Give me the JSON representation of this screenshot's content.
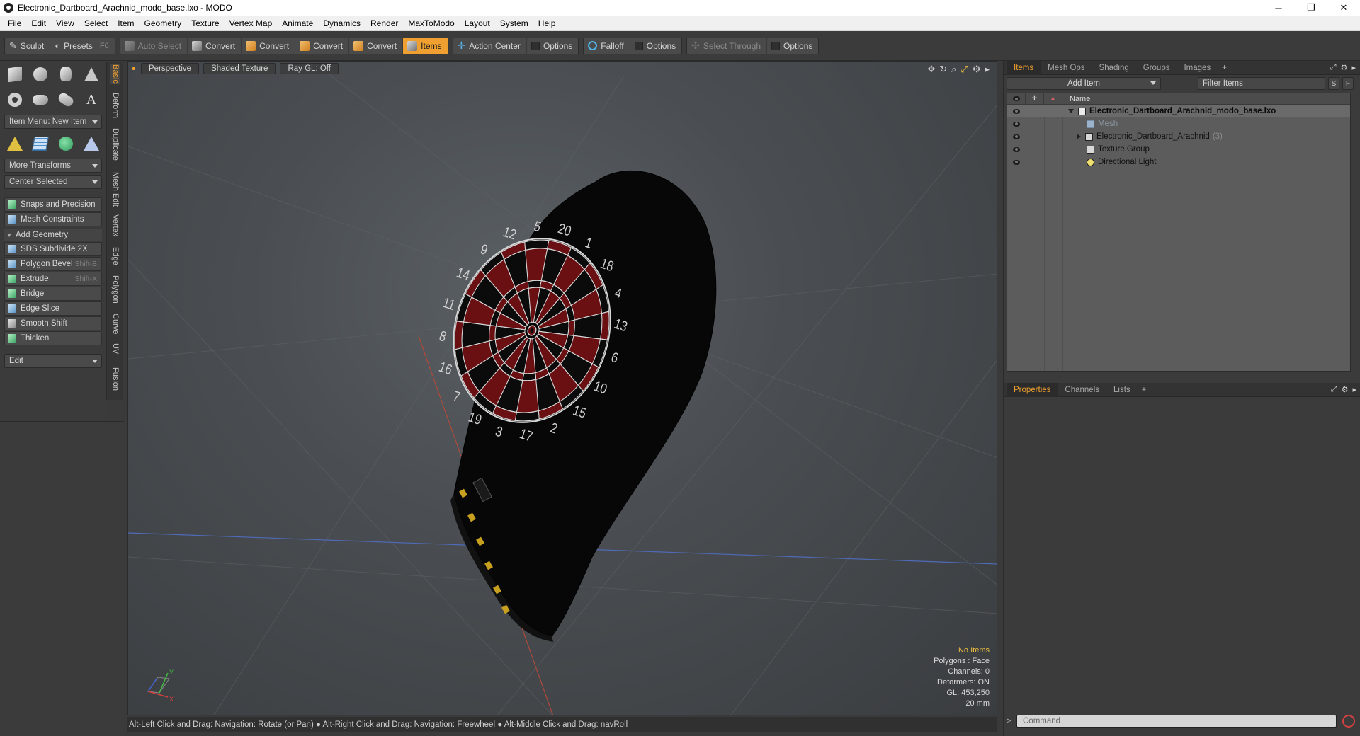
{
  "window": {
    "title": "Electronic_Dartboard_Arachnid_modo_base.lxo - MODO",
    "minimize": "─",
    "restore": "❐",
    "close": "✕"
  },
  "menu": [
    "File",
    "Edit",
    "View",
    "Select",
    "Item",
    "Geometry",
    "Texture",
    "Vertex Map",
    "Animate",
    "Dynamics",
    "Render",
    "MaxToModo",
    "Layout",
    "System",
    "Help"
  ],
  "toolbar": {
    "sculpt": "Sculpt",
    "presets": "Presets",
    "presets_shortcut": "F6",
    "auto_select": "Auto Select",
    "convert1": "Convert",
    "convert2": "Convert",
    "convert3": "Convert",
    "convert4": "Convert",
    "items": "Items",
    "action_center": "Action Center",
    "options1": "Options",
    "falloff": "Falloff",
    "options2": "Options",
    "select_through": "Select Through",
    "options3": "Options"
  },
  "left_panel": {
    "item_menu": "Item Menu: New Item",
    "more_transforms": "More Transforms",
    "center_selected": "Center Selected",
    "snaps": "Snaps and Precision",
    "mesh_constraints": "Mesh Constraints",
    "add_geometry": "Add Geometry",
    "tools": [
      {
        "label": "SDS Subdivide 2X",
        "shortcut": ""
      },
      {
        "label": "Polygon Bevel",
        "shortcut": "Shift-B"
      },
      {
        "label": "Extrude",
        "shortcut": "Shift-X"
      },
      {
        "label": "Bridge",
        "shortcut": ""
      },
      {
        "label": "Edge Slice",
        "shortcut": ""
      },
      {
        "label": "Smooth Shift",
        "shortcut": ""
      },
      {
        "label": "Thicken",
        "shortcut": ""
      }
    ],
    "edit": "Edit",
    "text_tool": "A"
  },
  "vtabs": [
    "Basic",
    "Deform",
    "Duplicate",
    "Mesh Edit",
    "Vertex",
    "Edge",
    "Polygon",
    "Curve",
    "UV",
    "Fusion"
  ],
  "viewport": {
    "view": "Perspective",
    "shading": "Shaded Texture",
    "raygl": "Ray GL: Off",
    "dart_numbers": [
      "20",
      "1",
      "18",
      "4",
      "13",
      "6",
      "10",
      "15",
      "2",
      "17",
      "3",
      "19",
      "7",
      "16",
      "8",
      "11",
      "14",
      "9",
      "12",
      "5"
    ],
    "info": {
      "selection": "No Items",
      "polygons": "Polygons : Face",
      "channels": "Channels: 0",
      "deformers": "Deformers: ON",
      "gl": "GL: 453,250",
      "scale": "20 mm"
    },
    "axis_y": "Y",
    "axis_x": "X"
  },
  "status": "Alt-Left Click and Drag: Navigation: Rotate (or Pan) ● Alt-Right Click and Drag: Navigation: Freewheel ● Alt-Middle Click and Drag: navRoll",
  "right_panel": {
    "tabs": [
      "Items",
      "Mesh Ops",
      "Shading",
      "Groups",
      "Images"
    ],
    "plus": "+",
    "add_item": "Add Item",
    "filter": "Filter Items",
    "s": "S",
    "f": "F",
    "name_col": "Name",
    "tree": [
      {
        "label": "Electronic_Dartboard_Arachnid_modo_base.lxo",
        "count": ""
      },
      {
        "label": "Mesh",
        "count": ""
      },
      {
        "label": "Electronic_Dartboard_Arachnid",
        "count": "(3)"
      },
      {
        "label": "Texture Group",
        "count": ""
      },
      {
        "label": "Directional Light",
        "count": ""
      }
    ],
    "prop_tabs": [
      "Properties",
      "Channels",
      "Lists"
    ],
    "command_placeholder": "Command",
    "cmd_arrow": ">"
  },
  "colors": {
    "accent": "#f0a030",
    "dart_red": "#6a0f12",
    "dart_black": "#0b0b0b"
  }
}
